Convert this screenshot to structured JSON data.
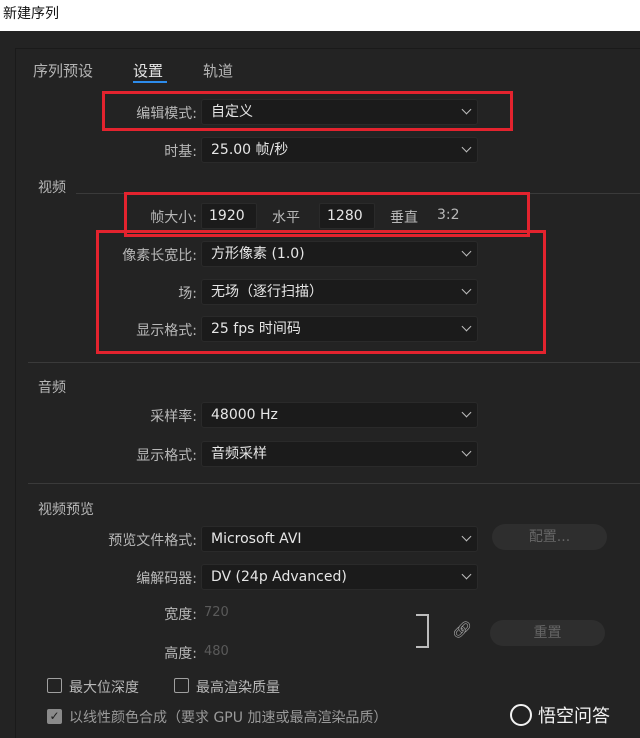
{
  "window": {
    "title": "新建序列"
  },
  "tabs": [
    {
      "label": "序列预设",
      "active": false
    },
    {
      "label": "设置",
      "active": true
    },
    {
      "label": "轨道",
      "active": false
    }
  ],
  "general": {
    "edit_mode": {
      "label": "编辑模式:",
      "value": "自定义"
    },
    "timebase": {
      "label": "时基:",
      "value": "25.00  帧/秒"
    }
  },
  "video": {
    "section": "视频",
    "frame_size": {
      "label": "帧大小:",
      "width": "1920",
      "width_label": "水平",
      "height": "1280",
      "height_label": "垂直",
      "ratio": "3:2"
    },
    "pixel_aspect": {
      "label": "像素长宽比:",
      "value": "方形像素 (1.0)"
    },
    "fields": {
      "label": "场:",
      "value": "无场（逐行扫描）"
    },
    "display_format": {
      "label": "显示格式:",
      "value": "25 fps 时间码"
    }
  },
  "audio": {
    "section": "音频",
    "sample_rate": {
      "label": "采样率:",
      "value": "48000 Hz"
    },
    "display_format": {
      "label": "显示格式:",
      "value": "音频采样"
    }
  },
  "preview": {
    "section": "视频预览",
    "file_format": {
      "label": "预览文件格式:",
      "value": "Microsoft AVI"
    },
    "configure_button": "配置...",
    "codec": {
      "label": "编解码器:",
      "value": "DV (24p Advanced)"
    },
    "width": {
      "label": "宽度:",
      "value": "720"
    },
    "height": {
      "label": "高度:",
      "value": "480"
    },
    "reset_button": "重置"
  },
  "options": {
    "max_bit_depth": {
      "label": "最大位深度",
      "checked": false
    },
    "max_render_quality": {
      "label": "最高渲染质量",
      "checked": false
    },
    "linear_color": {
      "label": "以线性颜色合成（要求 GPU 加速或最高渲染品质）",
      "checked": true
    }
  },
  "watermark": {
    "text": "悟空问答"
  },
  "colors": {
    "highlight_box": "#e3232e",
    "tab_accent": "#2d8ceb"
  }
}
